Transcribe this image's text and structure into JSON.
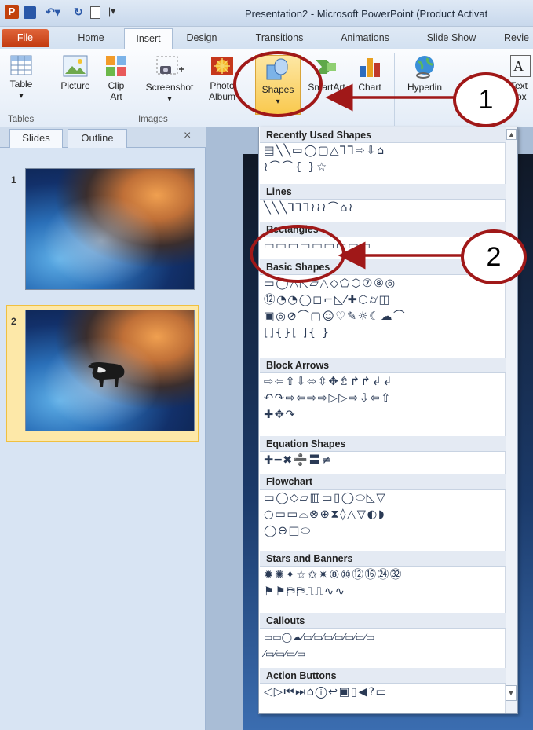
{
  "window": {
    "title": "Presentation2 - Microsoft PowerPoint (Product Activat"
  },
  "quick_access": {
    "icons": [
      "powerpoint-icon",
      "save-icon",
      "undo-icon",
      "redo-icon",
      "new-icon",
      "customize-icon"
    ]
  },
  "tabs": [
    {
      "label": "File"
    },
    {
      "label": "Home"
    },
    {
      "label": "Insert"
    },
    {
      "label": "Design"
    },
    {
      "label": "Transitions"
    },
    {
      "label": "Animations"
    },
    {
      "label": "Slide Show"
    },
    {
      "label": "Revie"
    }
  ],
  "ribbon": {
    "table": {
      "label": "Table",
      "arrow": "▾"
    },
    "picture": {
      "label": "Picture"
    },
    "clipart": {
      "label1": "Clip",
      "label2": "Art"
    },
    "screenshot": {
      "label": "Screenshot",
      "arrow": "▾"
    },
    "photoalbum": {
      "label1": "Photo",
      "label2": "Album"
    },
    "shapes": {
      "label": "Shapes",
      "arrow": "▾"
    },
    "smartart": {
      "label": "SmartArt"
    },
    "chart": {
      "label": "Chart"
    },
    "hyperlink": {
      "label": "Hyperlin"
    },
    "textbox": {
      "label1": "Text",
      "label2": "Box",
      "glyph": "A"
    },
    "groups": {
      "tables": "Tables",
      "images": "Images"
    }
  },
  "pane": {
    "tabs": [
      {
        "label": "Slides"
      },
      {
        "label": "Outline"
      }
    ],
    "close": "×",
    "slides": [
      {
        "number": "1"
      },
      {
        "number": "2"
      }
    ]
  },
  "dropdown": {
    "sections": [
      {
        "title": "Recently Used Shapes",
        "rows": [
          "▤╲╲▭◯▢△⅂⅂⇨⇩⌂",
          "≀⌒⌒{ }☆"
        ]
      },
      {
        "title": "Lines",
        "rows": [
          "╲╲╲⅂⅂⅂≀≀≀⌒⌂≀"
        ]
      },
      {
        "title": "Rectangles",
        "rows": [
          "▭▭▭▭▭▭▭▭▭"
        ]
      },
      {
        "title": "Basic Shapes",
        "rows": [
          "▭◯△◺▱△◇⬠⬡⑦⑧◎",
          "⑫◔◔◯◻⌐◺⁄✚⬡⌭◫",
          "▣◎⊘⌒▢☺♡✎☼☾☁⌒",
          "[]{}[ ]{ }"
        ]
      },
      {
        "title": "Block Arrows",
        "rows": [
          "⇨⇦⇧⇩⬄⇳✥⇯↱↱↲↲",
          "↶↷⇨⇦⇨⇨▷▷⇨⇩⇦⇧",
          "✚✥↷"
        ]
      },
      {
        "title": "Equation Shapes",
        "rows": [
          "✚━✖➗〓≠"
        ]
      },
      {
        "title": "Flowchart",
        "rows": [
          "▭◯◇▱▥▭▯◯⬭◺▽",
          "○▭▭⌓⊗⊕⧗◊△▽◐◗",
          "◯⊖◫⬭"
        ]
      },
      {
        "title": "Stars and Banners",
        "rows": [
          "✹✺✦☆✩✷⑧⑩⑫⑯㉔㉜",
          "⚑⚑⛿⛿⎍⎍∿∿"
        ]
      },
      {
        "title": "Callouts",
        "rows": [
          "▭▭◯☁⁄▭⁄▭⁄▭⁄▭⁄▭⁄▭⁄▭",
          "⁄▭⁄▭⁄▭⁄▭"
        ]
      },
      {
        "title": "Action Buttons",
        "rows": [
          "◁▷⏮⏭⌂ⓘ↩▣▯◀?▭"
        ]
      }
    ]
  },
  "annotations": [
    {
      "number": "1"
    },
    {
      "number": "2"
    }
  ],
  "colors": {
    "accent": "#a01818",
    "file_tab": "#d14a1c",
    "ribbon": "#e3ecf7",
    "selection": "#fde8a8"
  }
}
